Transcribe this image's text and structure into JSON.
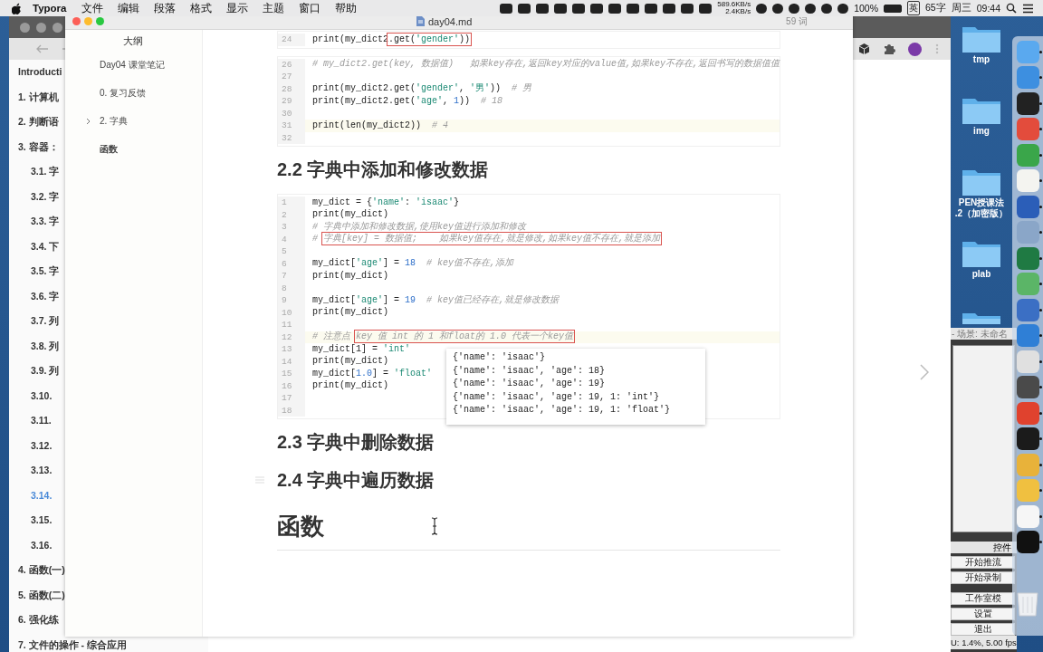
{
  "menu_bar": {
    "app": "Typora",
    "menus": [
      "文件",
      "编辑",
      "段落",
      "格式",
      "显示",
      "主题",
      "窗口",
      "帮助"
    ],
    "net_up": "589.6KB/s",
    "net_down": "2.4KB/s",
    "battery": "100%",
    "input_method": "英",
    "word_count": "65字",
    "weekday": "周三",
    "time": "09:44"
  },
  "browser": {
    "toc": [
      {
        "label": "Introducti",
        "selected": false
      },
      {
        "label": "1. 计算机",
        "selected": false
      },
      {
        "label": "2. 判断语",
        "selected": false
      },
      {
        "label": "3. 容器：",
        "selected": false,
        "children": [
          {
            "label": "3.1. 字",
            "selected": false
          },
          {
            "label": "3.2. 字",
            "selected": false
          },
          {
            "label": "3.3. 字",
            "selected": false
          },
          {
            "label": "3.4. 下",
            "selected": false
          },
          {
            "label": "3.5. 字",
            "selected": false
          },
          {
            "label": "3.6. 字",
            "selected": false
          },
          {
            "label": "3.7. 列",
            "selected": false
          },
          {
            "label": "3.8. 列",
            "selected": false
          },
          {
            "label": "3.9. 列",
            "selected": false
          },
          {
            "label": "3.10.",
            "selected": false
          },
          {
            "label": "3.11.",
            "selected": false
          },
          {
            "label": "3.12.",
            "selected": false
          },
          {
            "label": "3.13.",
            "selected": false
          },
          {
            "label": "3.14.",
            "selected": true
          },
          {
            "label": "3.15.",
            "selected": false
          },
          {
            "label": "3.16.",
            "selected": false
          }
        ]
      },
      {
        "label": "4. 函数(一)",
        "selected": false
      },
      {
        "label": "5. 函数(二)",
        "selected": false
      },
      {
        "label": "6. 强化练",
        "selected": false
      },
      {
        "label": "7. 文件的操作 - 综合应用",
        "selected": false
      }
    ]
  },
  "typora": {
    "title": "day04.md",
    "word_count": "59 词",
    "outline": {
      "title": "大纲",
      "items": [
        {
          "label": "Day04 课堂笔记",
          "bold": false,
          "expandable": false
        },
        {
          "label": "0. 复习反馈",
          "bold": false,
          "expandable": false
        },
        {
          "label": "2. 字典",
          "bold": false,
          "expandable": true
        },
        {
          "label": "函数",
          "bold": true,
          "expandable": false
        }
      ]
    },
    "doc": [
      {
        "kind": "code",
        "lines": [
          {
            "no": "24",
            "current": false,
            "parts": [
              {
                "kind": "plain",
                "text": "print(my_dict2"
              },
              {
                "kind": "box",
                "parts": [
                  {
                    "kind": "plain",
                    "text": ".get("
                  },
                  {
                    "kind": "str",
                    "text": "'gender'"
                  },
                  {
                    "kind": "plain",
                    "text": "))"
                  }
                ]
              }
            ]
          }
        ]
      },
      {
        "kind": "code",
        "lines": [
          {
            "no": "26",
            "current": false,
            "parts": [
              {
                "kind": "comment",
                "text": "# my_dict2.get(key, 数据值)   如果key存在,返回key对应的value值,如果key不存在,返回书写的数据值值"
              }
            ]
          },
          {
            "no": "27",
            "current": false
          },
          {
            "no": "28",
            "current": false,
            "parts": [
              {
                "kind": "plain",
                "text": "print(my_dict2.get("
              },
              {
                "kind": "str",
                "text": "'gender'"
              },
              {
                "kind": "plain",
                "text": ", "
              },
              {
                "kind": "str",
                "text": "'男'"
              },
              {
                "kind": "plain",
                "text": "))  "
              },
              {
                "kind": "comment",
                "text": "# 男"
              }
            ]
          },
          {
            "no": "29",
            "current": false,
            "parts": [
              {
                "kind": "plain",
                "text": "print(my_dict2.get("
              },
              {
                "kind": "str",
                "text": "'age'"
              },
              {
                "kind": "plain",
                "text": ", "
              },
              {
                "kind": "num",
                "text": "1"
              },
              {
                "kind": "plain",
                "text": "))  "
              },
              {
                "kind": "comment",
                "text": "# 18"
              }
            ]
          },
          {
            "no": "30",
            "current": false
          },
          {
            "no": "31",
            "current": true,
            "parts": [
              {
                "kind": "plain",
                "text": "print(len(my_dict2))  "
              },
              {
                "kind": "comment",
                "text": "# 4"
              }
            ]
          },
          {
            "no": "32",
            "current": false
          }
        ]
      },
      {
        "kind": "h2",
        "text": "2.2 字典中添加和修改数据",
        "handle": false
      },
      {
        "kind": "code",
        "lines": [
          {
            "no": "1",
            "current": false,
            "parts": [
              {
                "kind": "plain",
                "text": "my_dict = {"
              },
              {
                "kind": "str",
                "text": "'name'"
              },
              {
                "kind": "plain",
                "text": ": "
              },
              {
                "kind": "str",
                "text": "'isaac'"
              },
              {
                "kind": "plain",
                "text": "}"
              }
            ]
          },
          {
            "no": "2",
            "current": false,
            "parts": [
              {
                "kind": "plain",
                "text": "print(my_dict)"
              }
            ]
          },
          {
            "no": "3",
            "current": false,
            "parts": [
              {
                "kind": "comment",
                "text": "# 字典中添加和修改数据,使用key值进行添加和修改"
              }
            ]
          },
          {
            "no": "4",
            "current": false,
            "parts": [
              {
                "kind": "comment",
                "text": "# "
              },
              {
                "kind": "box",
                "parts": [
                  {
                    "kind": "comment",
                    "text": "字典[key] = 数据值;    如果key值存在,就是修改,如果key值不存在,就是添加"
                  }
                ]
              }
            ]
          },
          {
            "no": "5",
            "current": false
          },
          {
            "no": "6",
            "current": false,
            "parts": [
              {
                "kind": "plain",
                "text": "my_dict["
              },
              {
                "kind": "str",
                "text": "'age'"
              },
              {
                "kind": "plain",
                "text": "] = "
              },
              {
                "kind": "num",
                "text": "18"
              },
              {
                "kind": "comment",
                "text": "  # key值不存在,添加"
              }
            ]
          },
          {
            "no": "7",
            "current": false,
            "parts": [
              {
                "kind": "plain",
                "text": "print(my_dict)"
              }
            ]
          },
          {
            "no": "8",
            "current": false
          },
          {
            "no": "9",
            "current": false,
            "parts": [
              {
                "kind": "plain",
                "text": "my_dict["
              },
              {
                "kind": "str",
                "text": "'age'"
              },
              {
                "kind": "plain",
                "text": "] = "
              },
              {
                "kind": "num",
                "text": "19"
              },
              {
                "kind": "comment",
                "text": "  # key值已经存在,就是修改数据"
              }
            ]
          },
          {
            "no": "10",
            "current": false,
            "parts": [
              {
                "kind": "plain",
                "text": "print(my_dict)"
              }
            ]
          },
          {
            "no": "11",
            "current": false
          },
          {
            "no": "12",
            "current": true,
            "parts": [
              {
                "kind": "comment",
                "text": "# 注意点 "
              },
              {
                "kind": "box",
                "parts": [
                  {
                    "kind": "comment",
                    "text": "key 值 int 的 1 和float的 1.0 代表一个key值"
                  }
                ]
              }
            ]
          },
          {
            "no": "13",
            "current": false,
            "parts": [
              {
                "kind": "plain",
                "text": "my_dict[1] = "
              },
              {
                "kind": "str",
                "text": "'int'"
              }
            ]
          },
          {
            "no": "14",
            "current": false,
            "parts": [
              {
                "kind": "plain",
                "text": "print(my_dict)"
              }
            ]
          },
          {
            "no": "15",
            "current": false,
            "parts": [
              {
                "kind": "plain",
                "text": "my_dict["
              },
              {
                "kind": "num",
                "text": "1.0"
              },
              {
                "kind": "plain",
                "text": "] = "
              },
              {
                "kind": "str",
                "text": "'float'"
              }
            ]
          },
          {
            "no": "16",
            "current": false,
            "parts": [
              {
                "kind": "plain",
                "text": "print(my_dict)"
              }
            ]
          },
          {
            "no": "17",
            "current": false
          },
          {
            "no": "18",
            "current": false
          }
        ],
        "output": [
          "{'name': 'isaac'}",
          "{'name': 'isaac', 'age': 18}",
          "{'name': 'isaac', 'age': 19}",
          "{'name': 'isaac', 'age': 19, 1: 'int'}",
          "{'name': 'isaac', 'age': 19, 1: 'float'}"
        ]
      },
      {
        "kind": "h2",
        "text": "2.3 字典中删除数据",
        "handle": false
      },
      {
        "kind": "h2",
        "text": "2.4 字典中遍历数据",
        "handle": true
      },
      {
        "kind": "h1",
        "text": "函数"
      }
    ]
  },
  "desktop": {
    "folders": [
      {
        "kind": "folder",
        "lines": [
          "tmp"
        ]
      },
      {
        "kind": "folder",
        "lines": [
          "img"
        ]
      },
      {
        "kind": "folder",
        "lines": [
          "PEN授课法",
          ".2（加密版）"
        ]
      },
      {
        "kind": "folder",
        "lines": [
          "plab"
        ]
      },
      {
        "kind": "partial"
      }
    ]
  },
  "obs": {
    "title": "- 场景: 未命名",
    "panel_title": "控件",
    "buttons": [
      "开始推流",
      "开始录制",
      "工作室模",
      "设置",
      "退出"
    ],
    "status": "U: 1.4%, 5.00 fps"
  },
  "dock": [
    {
      "running": true
    },
    {
      "running": true
    },
    {
      "running": true
    },
    {
      "running": true
    },
    {
      "running": true
    },
    {
      "running": true
    },
    {
      "running": true
    },
    {
      "running": true
    },
    {
      "running": true
    },
    {
      "running": true
    },
    {
      "running": true
    },
    {
      "running": true
    },
    {
      "running": true
    },
    {
      "running": true
    },
    {
      "running": true
    },
    {
      "running": true
    },
    {
      "running": true
    },
    {
      "running": true
    },
    {
      "running": true
    },
    {
      "running": true
    }
  ]
}
